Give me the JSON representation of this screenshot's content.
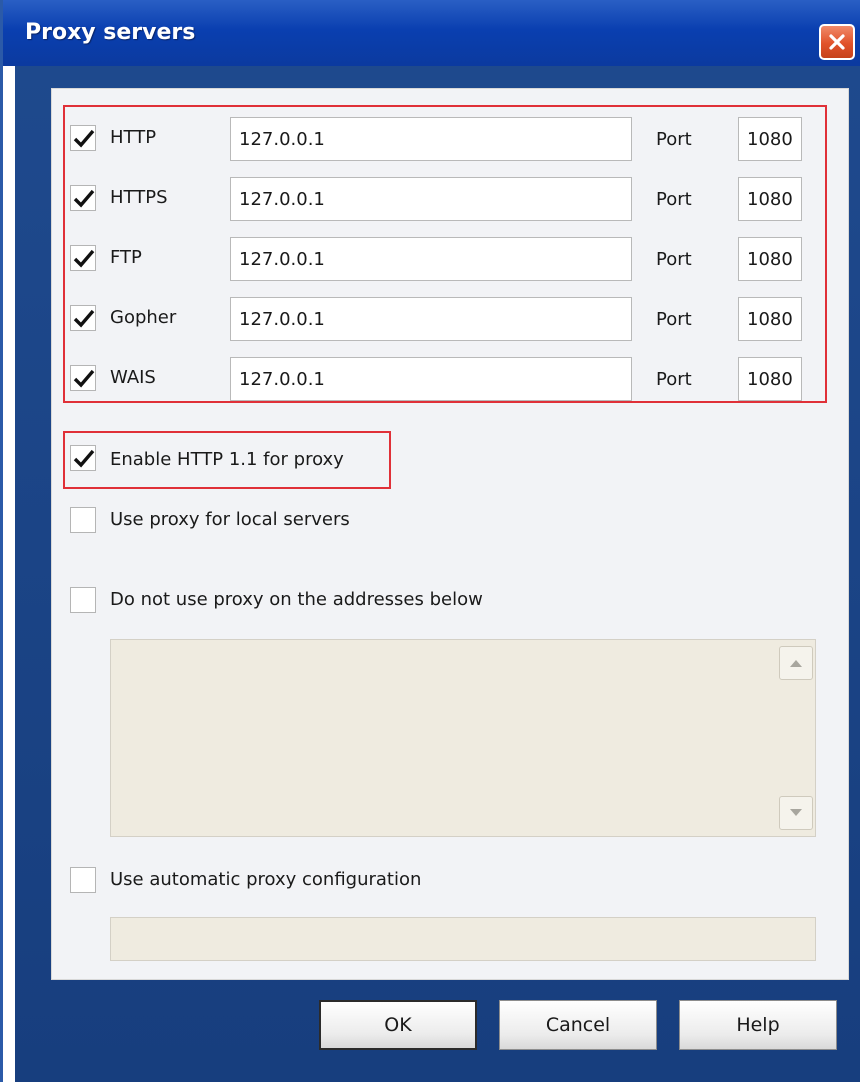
{
  "window": {
    "title": "Proxy servers",
    "close_icon": "close-icon"
  },
  "proxies": [
    {
      "checked": true,
      "protocol": "HTTP",
      "address": "127.0.0.1",
      "port_label": "Port",
      "port": "1080"
    },
    {
      "checked": true,
      "protocol": "HTTPS",
      "address": "127.0.0.1",
      "port_label": "Port",
      "port": "1080"
    },
    {
      "checked": true,
      "protocol": "FTP",
      "address": "127.0.0.1",
      "port_label": "Port",
      "port": "1080"
    },
    {
      "checked": true,
      "protocol": "Gopher",
      "address": "127.0.0.1",
      "port_label": "Port",
      "port": "1080"
    },
    {
      "checked": true,
      "protocol": "WAIS",
      "address": "127.0.0.1",
      "port_label": "Port",
      "port": "1080"
    }
  ],
  "options": {
    "enable_http11": {
      "checked": true,
      "label": "Enable HTTP 1.1 for proxy"
    },
    "local_servers": {
      "checked": false,
      "label": "Use proxy for local servers"
    },
    "bypass": {
      "checked": false,
      "label": "Do not use proxy on the addresses below"
    },
    "auto_config": {
      "checked": false,
      "label": "Use automatic proxy configuration"
    }
  },
  "bypass_addresses": "",
  "auto_config_url": "",
  "buttons": {
    "ok": "OK",
    "cancel": "Cancel",
    "help": "Help"
  },
  "colors": {
    "titlebar": "#0a3fb0",
    "highlight": "#e03038",
    "disabled_field": "#efebe0"
  }
}
